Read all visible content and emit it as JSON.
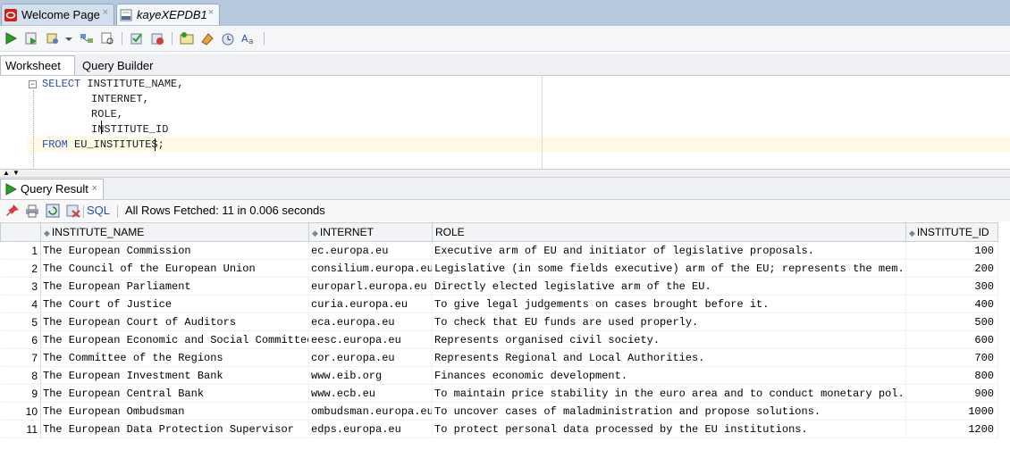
{
  "tabs": {
    "welcome": "Welcome Page",
    "connection": "kayeXEPDB1",
    "close_glyph": "×"
  },
  "toolbar_icons": [
    "run-statement-icon",
    "run-script-icon",
    "autotrace-icon",
    "dropdown-icon",
    "explain-plan-icon",
    "sql-tuning-icon",
    "commit-icon",
    "rollback-icon",
    "unshared-sql-icon",
    "clear-icon",
    "sql-history-icon",
    "format-icon"
  ],
  "worksheet_tabs": {
    "worksheet": "Worksheet",
    "query_builder": "Query Builder"
  },
  "editor": {
    "select_kw": "SELECT",
    "line1_rest": " INSTITUTE_NAME,",
    "line2": "INTERNET,",
    "line3": "ROLE,",
    "line4": "INSTITUTE_ID",
    "from_kw": "FROM",
    "line5_rest": " EU_INSTITUTES;"
  },
  "result": {
    "tab_label": "Query Result",
    "sql_link": "SQL",
    "status": "All Rows Fetched: 11 in 0.006 seconds",
    "columns": [
      "INSTITUTE_NAME",
      "INTERNET",
      "ROLE",
      "INSTITUTE_ID"
    ],
    "rows": [
      [
        "1",
        "The European Commission",
        "ec.europa.eu",
        "Executive arm of EU and initiator of legislative proposals.",
        "100"
      ],
      [
        "2",
        "The Council of the European Union",
        "consilium.europa.eu",
        "Legislative (in some fields executive) arm of the EU; represents the mem...",
        "200"
      ],
      [
        "3",
        "The European Parliament",
        "europarl.europa.eu",
        "Directly elected legislative arm of the EU.",
        "300"
      ],
      [
        "4",
        "The Court of Justice",
        "curia.europa.eu",
        "To give legal judgements on cases brought before it.",
        "400"
      ],
      [
        "5",
        "The European Court of Auditors",
        "eca.europa.eu",
        "To check that EU funds are used properly.",
        "500"
      ],
      [
        "6",
        "The European Economic and Social Committee",
        "eesc.europa.eu",
        "Represents organised civil society.",
        "600"
      ],
      [
        "7",
        "The Committee of the Regions",
        "cor.europa.eu",
        "Represents Regional and Local Authorities.",
        "700"
      ],
      [
        "8",
        "The European Investment Bank",
        "www.eib.org",
        "Finances economic development.",
        "800"
      ],
      [
        "9",
        "The European Central Bank",
        "www.ecb.eu",
        "To maintain price stability in the euro area and to conduct monetary pol...",
        "900"
      ],
      [
        "10",
        "The European Ombudsman",
        "ombudsman.europa.eu",
        "To uncover cases of maladministration and propose solutions.",
        "1000"
      ],
      [
        "11",
        "The European Data Protection Supervisor",
        "edps.europa.eu",
        "To protect personal data processed by the EU institutions.",
        "1200"
      ]
    ]
  }
}
